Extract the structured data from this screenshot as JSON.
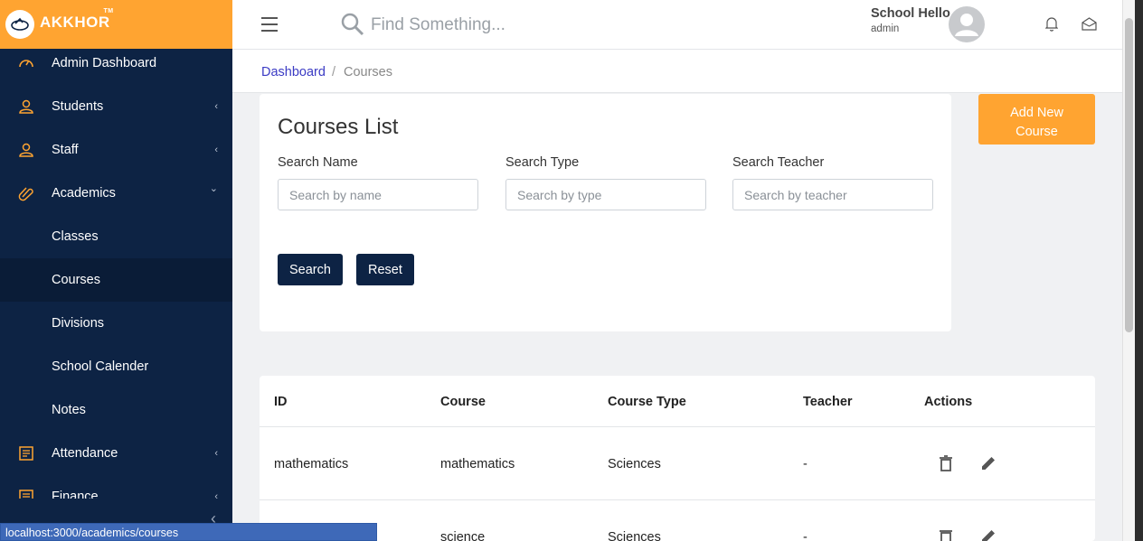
{
  "brand": {
    "name": "AKKHOR",
    "tm": "TM",
    "accent": "#ffa431",
    "sidebar_bg": "#0d2344"
  },
  "header": {
    "search_placeholder": "Find Something...",
    "user_name": "School Hello",
    "user_role": "admin"
  },
  "sidebar": {
    "items": [
      {
        "label": "Admin Dashboard",
        "icon": "speedometer-icon",
        "chevron": ""
      },
      {
        "label": "Students",
        "icon": "students-icon",
        "chevron": "‹"
      },
      {
        "label": "Staff",
        "icon": "staff-icon",
        "chevron": "‹"
      },
      {
        "label": "Academics",
        "icon": "paperclip-icon",
        "chevron": "⌄"
      },
      {
        "label": "Classes"
      },
      {
        "label": "Courses"
      },
      {
        "label": "Divisions"
      },
      {
        "label": "School Calender"
      },
      {
        "label": "Notes"
      },
      {
        "label": "Attendance",
        "icon": "list-icon",
        "chevron": "‹"
      },
      {
        "label": "Finance",
        "icon": "list-icon",
        "chevron": "‹"
      }
    ],
    "collapse": "‹"
  },
  "breadcrumb": {
    "home": "Dashboard",
    "separator": "/",
    "current": "Courses"
  },
  "filters": {
    "title": "Courses List",
    "name_label": "Search Name",
    "name_placeholder": "Search by name",
    "type_label": "Search Type",
    "type_placeholder": "Search by type",
    "teacher_label": "Search Teacher",
    "teacher_placeholder": "Search by teacher",
    "search_btn": "Search",
    "reset_btn": "Reset"
  },
  "add_button": {
    "line1": "Add New",
    "line2": "Course"
  },
  "table": {
    "columns": [
      "ID",
      "Course",
      "Course Type",
      "Teacher",
      "Actions"
    ],
    "rows": [
      [
        "mathematics",
        "mathematics",
        "Sciences",
        "-"
      ],
      [
        "",
        "science",
        "Sciences",
        "-"
      ]
    ]
  },
  "status_url": "localhost:3000/academics/courses"
}
